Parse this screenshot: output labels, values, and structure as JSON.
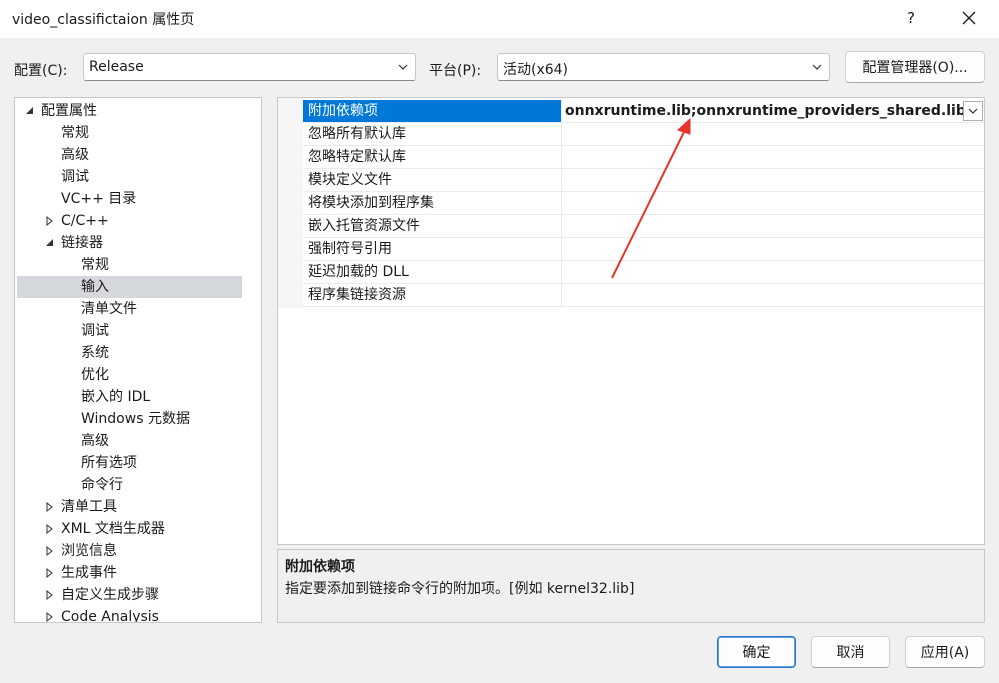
{
  "window": {
    "title": "video_classifictaion 属性页",
    "help_label": "?"
  },
  "config_bar": {
    "config_label": "配置(C):",
    "config_value": "Release",
    "platform_label": "平台(P):",
    "platform_value": "活动(x64)",
    "manager_button": "配置管理器(O)..."
  },
  "tree": {
    "items": [
      {
        "label": "配置属性",
        "indent": 0,
        "arrow": "expanded"
      },
      {
        "label": "常规",
        "indent": 1,
        "arrow": "none"
      },
      {
        "label": "高级",
        "indent": 1,
        "arrow": "none"
      },
      {
        "label": "调试",
        "indent": 1,
        "arrow": "none"
      },
      {
        "label": "VC++ 目录",
        "indent": 1,
        "arrow": "none"
      },
      {
        "label": "C/C++",
        "indent": 1,
        "arrow": "collapsed"
      },
      {
        "label": "链接器",
        "indent": 1,
        "arrow": "expanded"
      },
      {
        "label": "常规",
        "indent": 2,
        "arrow": "none"
      },
      {
        "label": "输入",
        "indent": 2,
        "arrow": "none",
        "selected": true
      },
      {
        "label": "清单文件",
        "indent": 2,
        "arrow": "none"
      },
      {
        "label": "调试",
        "indent": 2,
        "arrow": "none"
      },
      {
        "label": "系统",
        "indent": 2,
        "arrow": "none"
      },
      {
        "label": "优化",
        "indent": 2,
        "arrow": "none"
      },
      {
        "label": "嵌入的 IDL",
        "indent": 2,
        "arrow": "none"
      },
      {
        "label": "Windows 元数据",
        "indent": 2,
        "arrow": "none"
      },
      {
        "label": "高级",
        "indent": 2,
        "arrow": "none"
      },
      {
        "label": "所有选项",
        "indent": 2,
        "arrow": "none"
      },
      {
        "label": "命令行",
        "indent": 2,
        "arrow": "none"
      },
      {
        "label": "清单工具",
        "indent": 1,
        "arrow": "collapsed"
      },
      {
        "label": "XML 文档生成器",
        "indent": 1,
        "arrow": "collapsed"
      },
      {
        "label": "浏览信息",
        "indent": 1,
        "arrow": "collapsed"
      },
      {
        "label": "生成事件",
        "indent": 1,
        "arrow": "collapsed"
      },
      {
        "label": "自定义生成步骤",
        "indent": 1,
        "arrow": "collapsed"
      },
      {
        "label": "Code Analysis",
        "indent": 1,
        "arrow": "collapsed"
      }
    ]
  },
  "grid": {
    "rows": [
      {
        "name": "附加依赖项",
        "value": "onnxruntime.lib;onnxruntime_providers_shared.lib;%",
        "selected": true
      },
      {
        "name": "忽略所有默认库",
        "value": ""
      },
      {
        "name": "忽略特定默认库",
        "value": ""
      },
      {
        "name": "模块定义文件",
        "value": ""
      },
      {
        "name": "将模块添加到程序集",
        "value": ""
      },
      {
        "name": "嵌入托管资源文件",
        "value": ""
      },
      {
        "name": "强制符号引用",
        "value": ""
      },
      {
        "name": "延迟加载的 DLL",
        "value": ""
      },
      {
        "name": "程序集链接资源",
        "value": ""
      }
    ]
  },
  "description": {
    "title": "附加依赖项",
    "text": "指定要添加到链接命令行的附加项。[例如 kernel32.lib]"
  },
  "footer": {
    "ok": "确定",
    "cancel": "取消",
    "apply": "应用(A)"
  },
  "colors": {
    "selection": "#0078d7",
    "annotation_arrow": "#e8332a",
    "tree_selection": "#d4d7dc"
  }
}
